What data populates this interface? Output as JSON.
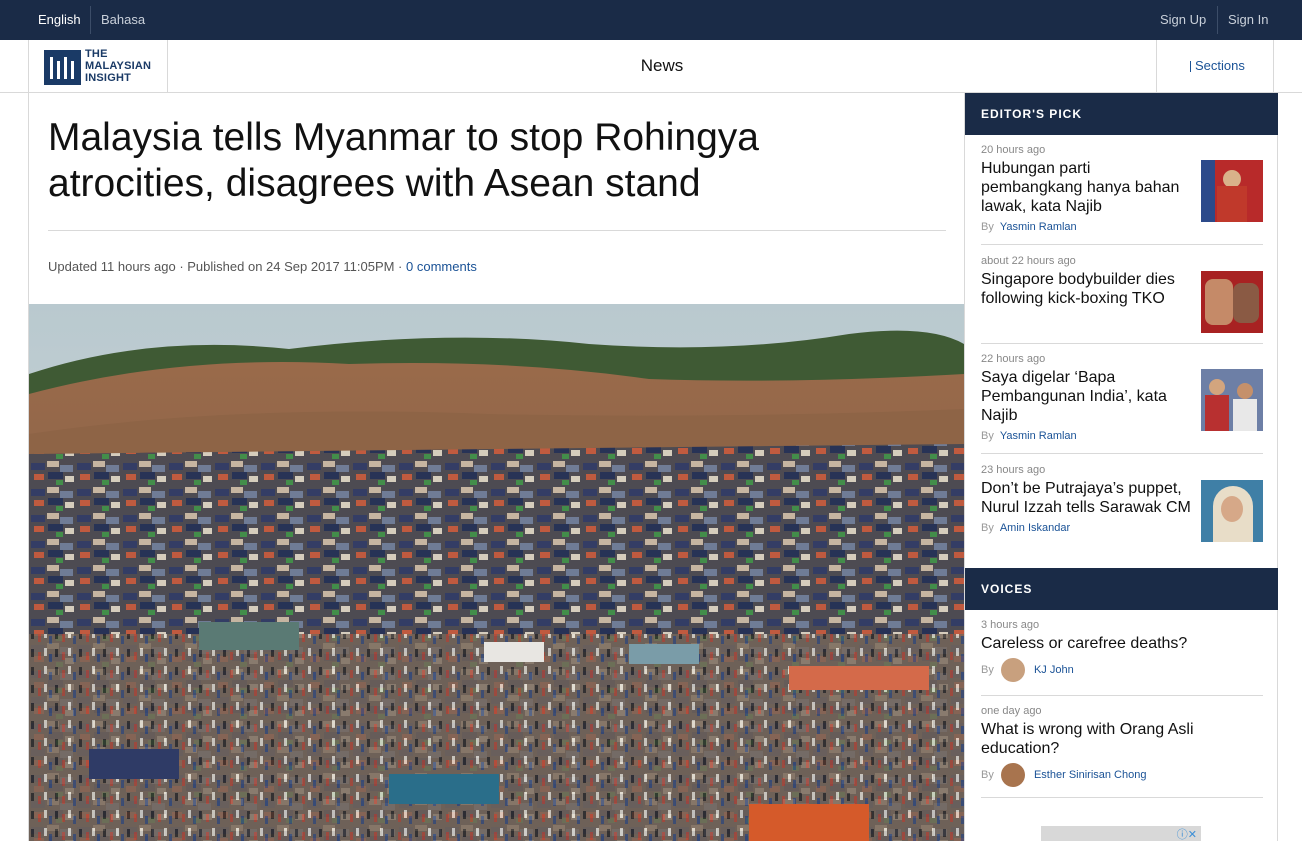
{
  "topbar": {
    "lang_english": "English",
    "lang_bahasa": "Bahasa",
    "sign_up": "Sign Up",
    "sign_in": "Sign In"
  },
  "header": {
    "logo_line1": "THE",
    "logo_line2": "MALAYSIAN",
    "logo_line3": "INSIGHT",
    "section": "News",
    "sections_label": "Sections"
  },
  "article": {
    "headline_line1": "Malaysia tells Myanmar to stop Rohingya",
    "headline_line2": "atrocities, disagrees with Asean stand",
    "updated": "Updated 11 hours ago",
    "published": " · Published on 24 Sep 2017 11:05PM · ",
    "comments": "0 comments"
  },
  "editors_pick": {
    "heading": "EDITOR'S PICK",
    "by_label": "By",
    "items": [
      {
        "time": "20 hours ago",
        "title": "Hubungan parti pembangkang hanya bahan lawak, kata Najib",
        "author": "Yasmin Ramlan"
      },
      {
        "time": "about 22 hours ago",
        "title": "Singapore bodybuilder dies following kick-boxing TKO",
        "author": ""
      },
      {
        "time": "22 hours ago",
        "title": "Saya digelar ‘Bapa Pembangunan India’, kata Najib",
        "author": "Yasmin Ramlan"
      },
      {
        "time": "23 hours ago",
        "title": "Don’t be Putrajaya’s puppet, Nurul Izzah tells Sarawak CM",
        "author": "Amin Iskandar"
      }
    ]
  },
  "voices": {
    "heading": "VOICES",
    "by_label": "By",
    "items": [
      {
        "time": "3 hours ago",
        "title": "Careless or carefree deaths?",
        "author": "KJ John"
      },
      {
        "time": "one day ago",
        "title": "What is wrong with Orang Asli education?",
        "author": "Esther Sinirisan Chong"
      }
    ]
  },
  "ad": {
    "badge": "ⓘ✕"
  },
  "colors": {
    "navy": "#1a2b47",
    "link": "#1a5296",
    "logo": "#1a3a66"
  }
}
